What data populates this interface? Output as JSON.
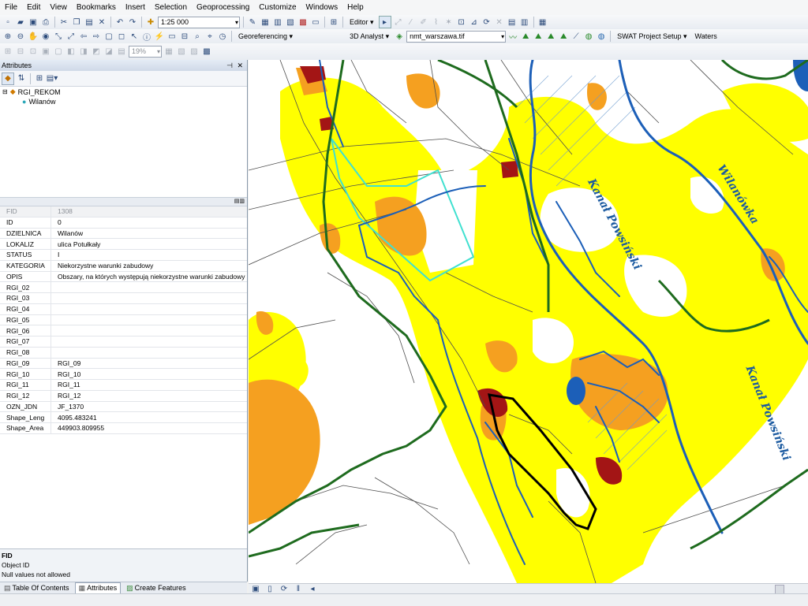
{
  "menu": [
    "File",
    "Edit",
    "View",
    "Bookmarks",
    "Insert",
    "Selection",
    "Geoprocessing",
    "Customize",
    "Windows",
    "Help"
  ],
  "toolbar1": {
    "scale": "1:25 000",
    "editor_label": "Editor"
  },
  "toolbar2": {
    "georef_label": "Georeferencing",
    "analyst_label": "3D Analyst",
    "raster_layer": "nmt_warszawa.tif",
    "swat_label": "SWAT Project Setup",
    "waters_label": "Waters"
  },
  "toolbar3": {
    "zoom_percent": "19%"
  },
  "attributes_panel": {
    "title": "Attributes",
    "tree": {
      "layer": "RGI_REKOM",
      "feature": "Wilanów"
    },
    "rows": [
      {
        "k": "FID",
        "v": "1308"
      },
      {
        "k": "ID",
        "v": "0"
      },
      {
        "k": "DZIELNICA",
        "v": "Wilanów"
      },
      {
        "k": "LOKALIZ",
        "v": "ulica Potułkały"
      },
      {
        "k": "STATUS",
        "v": "I"
      },
      {
        "k": "KATEGORIA",
        "v": "Niekorzystne warunki zabudowy"
      },
      {
        "k": "OPIS",
        "v": "Obszary, na których występują niekorzystne warunki zabudowy"
      },
      {
        "k": "RGI_02",
        "v": ""
      },
      {
        "k": "RGI_03",
        "v": ""
      },
      {
        "k": "RGI_04",
        "v": ""
      },
      {
        "k": "RGI_05",
        "v": ""
      },
      {
        "k": "RGI_06",
        "v": ""
      },
      {
        "k": "RGI_07",
        "v": ""
      },
      {
        "k": "RGI_08",
        "v": ""
      },
      {
        "k": "RGI_09",
        "v": "RGI_09"
      },
      {
        "k": "RGI_10",
        "v": "RGI_10"
      },
      {
        "k": "RGI_11",
        "v": "RGI_11"
      },
      {
        "k": "RGI_12",
        "v": "RGI_12"
      },
      {
        "k": "OZN_JDN",
        "v": "JF_1370"
      },
      {
        "k": "Shape_Leng",
        "v": "4095.483241"
      },
      {
        "k": "Shape_Area",
        "v": "449903.809955"
      }
    ],
    "info": {
      "field": "FID",
      "alias": "Object ID",
      "nulls": "Null values not allowed"
    }
  },
  "bottom_tabs": [
    {
      "label": "Table Of Contents",
      "active": false
    },
    {
      "label": "Attributes",
      "active": true
    },
    {
      "label": "Create Features",
      "active": false
    }
  ],
  "map": {
    "labels": [
      "Kanał Powsiński",
      "Wilanówka",
      "Kanał Powsiński"
    ],
    "colors": {
      "yellow": "#ffff00",
      "orange": "#f5a020",
      "darkred": "#a31515",
      "blue": "#1c5fb8",
      "green": "#1e6b1e",
      "black": "#000000"
    }
  }
}
